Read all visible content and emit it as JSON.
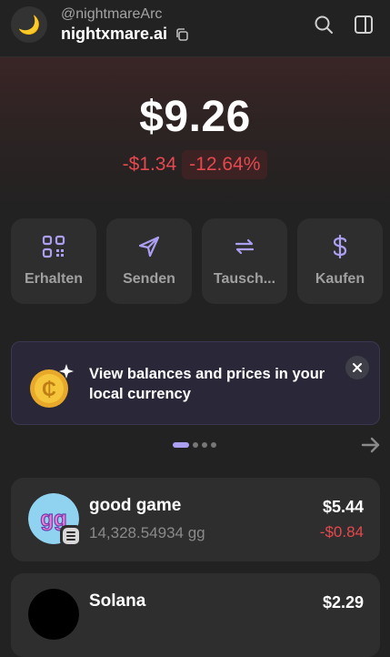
{
  "header": {
    "username": "@nightmareArc",
    "account_name": "nightxmare.ai",
    "avatar_emoji": "🌙"
  },
  "balance": {
    "total": "$9.26",
    "change_abs": "-$1.34",
    "change_pct": "-12.64%"
  },
  "actions": [
    {
      "label": "Erhalten",
      "icon": "qr-code-icon"
    },
    {
      "label": "Senden",
      "icon": "send-icon"
    },
    {
      "label": "Tausch...",
      "icon": "swap-icon"
    },
    {
      "label": "Kaufen",
      "icon": "dollar-icon"
    }
  ],
  "banner": {
    "text": "View balances and prices in your local currency"
  },
  "carousel": {
    "pages": 4,
    "active": 0
  },
  "tokens": [
    {
      "name": "good game",
      "amount": "14,328.54934 gg",
      "value": "$5.44",
      "delta": "-$0.84"
    },
    {
      "name": "Solana",
      "amount": "",
      "value": "$2.29",
      "delta": ""
    }
  ],
  "colors": {
    "background": "#222222",
    "card": "#2e2e2e",
    "accent": "#ab9ff2",
    "negative": "#e5484d"
  }
}
